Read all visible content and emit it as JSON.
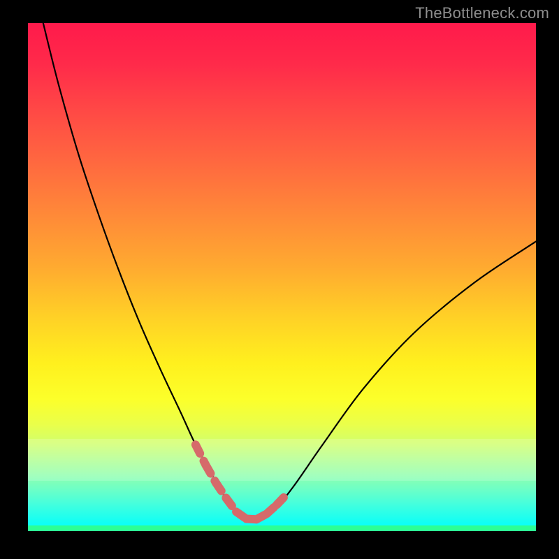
{
  "watermark": {
    "text": "TheBottleneck.com"
  },
  "colors": {
    "background": "#000000",
    "curve": "#000000",
    "marker": "#d66a6a",
    "watermark": "#8e8e8e"
  },
  "chart_data": {
    "type": "line",
    "title": "",
    "xlabel": "",
    "ylabel": "",
    "xlim": [
      0,
      100
    ],
    "ylim": [
      0,
      100
    ],
    "grid": false,
    "legend": false,
    "series": [
      {
        "name": "bottleneck-curve",
        "x": [
          3,
          6,
          10,
          14,
          18,
          22,
          26,
          30,
          33,
          36,
          38.5,
          40.5,
          42.5,
          44,
          46,
          48,
          52,
          58,
          66,
          76,
          88,
          100
        ],
        "values": [
          100,
          88,
          74,
          62,
          51,
          41,
          32,
          23.5,
          17,
          11.5,
          7.2,
          4.4,
          2.7,
          2.1,
          2.4,
          3.6,
          8.4,
          17,
          28,
          39,
          49,
          57
        ]
      }
    ],
    "markers": {
      "name": "highlight-segment",
      "x": [
        33,
        35,
        37,
        39,
        41,
        43,
        45,
        47,
        49,
        51
      ],
      "values": [
        17,
        13,
        9.5,
        6.5,
        3.8,
        2.4,
        2.3,
        3.4,
        5.2,
        7.3
      ]
    }
  }
}
